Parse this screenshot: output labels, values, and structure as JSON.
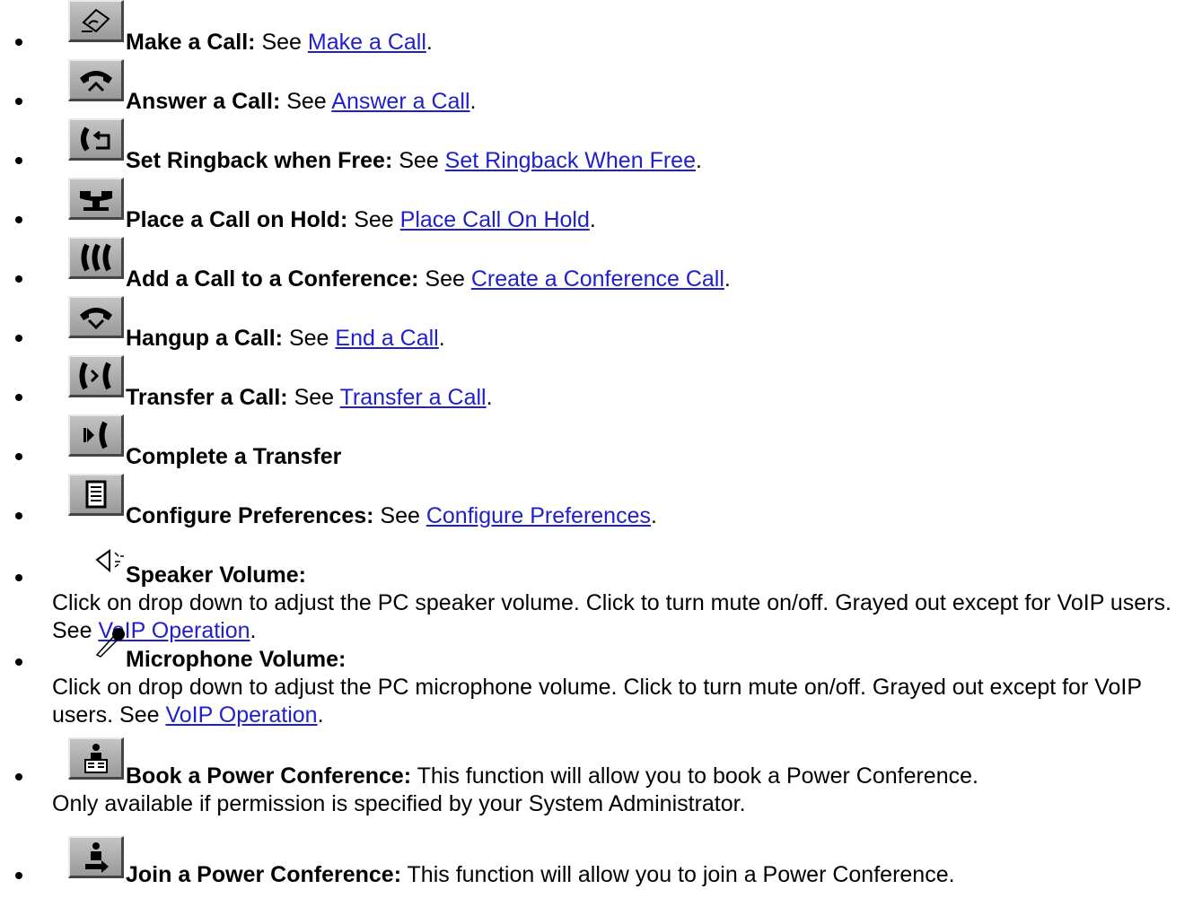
{
  "items": [
    {
      "icon": "make-call-icon",
      "title": "Make a Call:",
      "see": " See ",
      "link": "Make a Call",
      "end": "."
    },
    {
      "icon": "answer-call-icon",
      "title": "Answer a Call:",
      "see": " See ",
      "link": "Answer a Call",
      "end": "."
    },
    {
      "icon": "ringback-icon",
      "title": "Set Ringback when Free:",
      "see": " See ",
      "link": "Set Ringback When Free",
      "end": "."
    },
    {
      "icon": "hold-icon",
      "title": "Place a Call on Hold:",
      "see": " See ",
      "link": "Place Call On Hold",
      "end": "."
    },
    {
      "icon": "conference-icon",
      "title": "Add a Call to a Conference:",
      "see": " See ",
      "link": "Create a Conference Call",
      "end": "."
    },
    {
      "icon": "hangup-icon",
      "title": "Hangup a Call:",
      "see": " See ",
      "link": "End a Call",
      "end": "."
    },
    {
      "icon": "transfer-icon",
      "title": "Transfer a Call:",
      "see": " See ",
      "link": "Transfer a Call",
      "end": "."
    },
    {
      "icon": "complete-transfer-icon",
      "title": "Complete a Transfer"
    },
    {
      "icon": "preferences-icon",
      "title": "Configure Preferences:",
      "see": " See ",
      "link": "Configure Preferences",
      "end": "."
    },
    {
      "icon": "speaker-icon",
      "title": "Speaker Volume:",
      "desc": "Click on drop down to adjust the PC speaker volume. Click to turn mute on/off. Grayed out except for VoIP users. See ",
      "link": "VoIP Operation",
      "end": "."
    },
    {
      "icon": "microphone-icon",
      "title": "Microphone Volume:",
      "desc": "Click on drop down to adjust the PC microphone volume. Click to turn mute on/off. Grayed out except for VoIP users. See ",
      "link": "VoIP Operation",
      "end": "."
    },
    {
      "icon": "book-conference-icon",
      "title": "Book a Power Conference:",
      "text": " This function will allow you to book a Power Conference.",
      "desc": "Only available if permission is specified by your System Administrator."
    },
    {
      "icon": "join-conference-icon",
      "title": "Join a Power Conference:",
      "text": " This function will allow you to join a Power Conference."
    }
  ]
}
